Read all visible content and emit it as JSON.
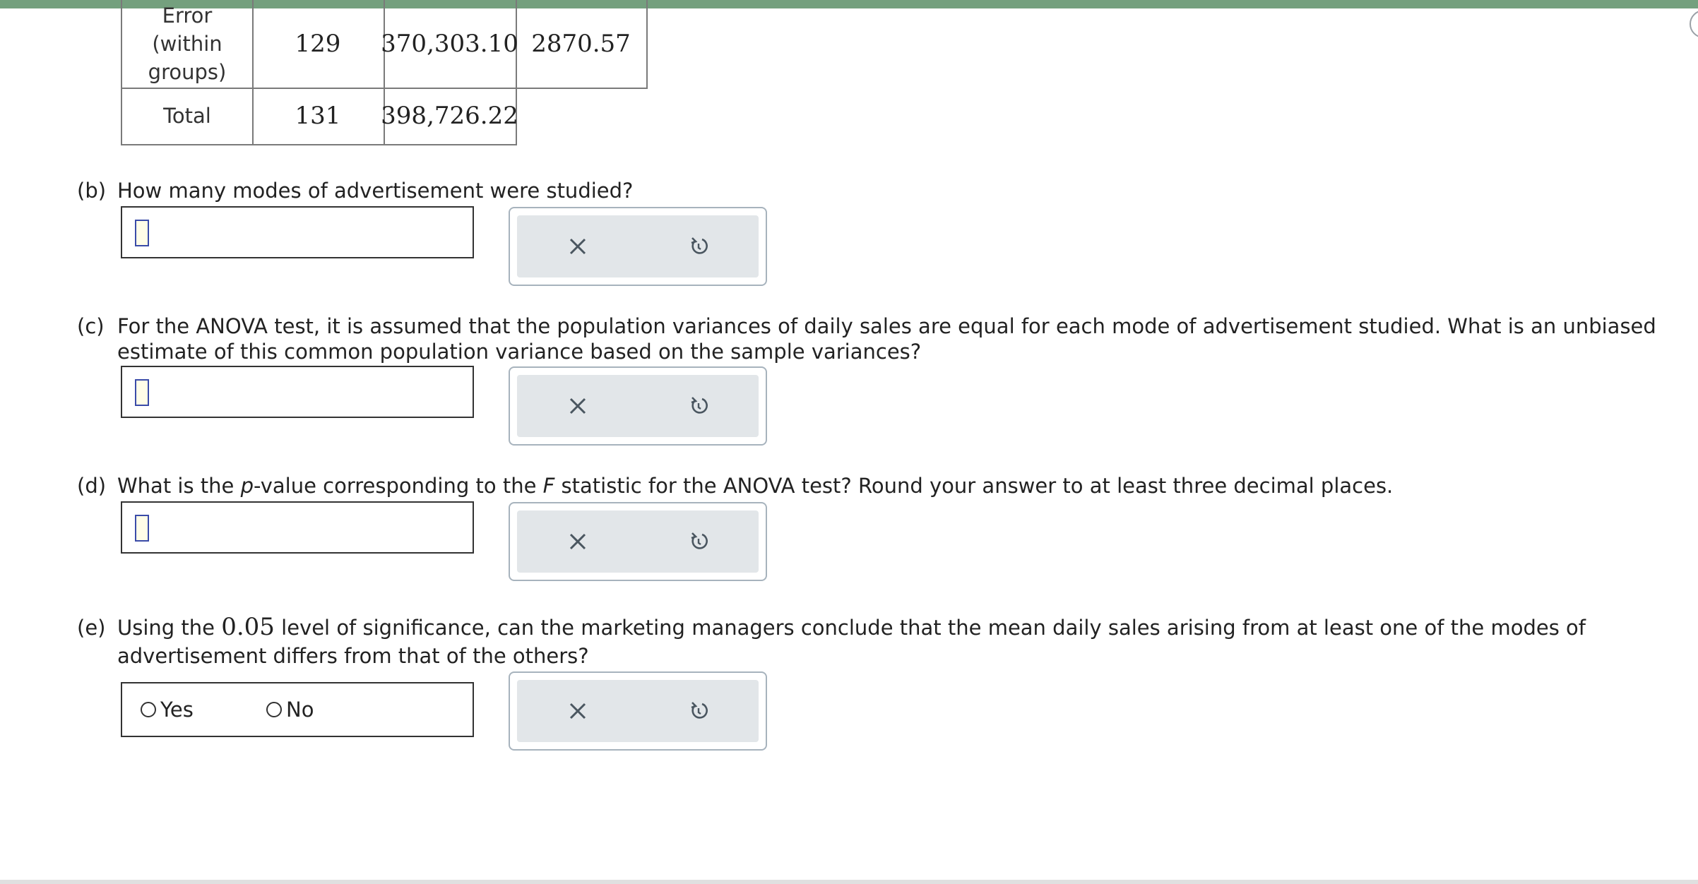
{
  "anova_table": {
    "rows": [
      {
        "source_label": "Error (within groups)",
        "df": "129",
        "ss": "370,303.10",
        "ms": "2870.57"
      },
      {
        "source_label": "Total",
        "df": "131",
        "ss": "398,726.22"
      }
    ]
  },
  "questions": {
    "b": {
      "prefix": "(b)",
      "text": "How many modes of advertisement were studied?"
    },
    "c": {
      "prefix": "(c)",
      "line1": "For the ANOVA test, it is assumed that the population variances of daily sales are equal for each mode of advertisement studied. What is an unbiased",
      "line2": "estimate of this common population variance based on the sample variances?"
    },
    "d": {
      "prefix": "(d)",
      "part1": "What is the ",
      "p": "p",
      "part2": "-value corresponding to the ",
      "F": "F",
      "part3": " statistic for the ANOVA test? Round your answer to at least three decimal places."
    },
    "e": {
      "prefix": "(e)",
      "part1": "Using the ",
      "alpha": "0.05",
      "part2": " level of significance, can the marketing managers conclude that the mean daily sales arising from at least one of the modes of",
      "line2": "advertisement differs from that of the others?",
      "options": [
        "Yes",
        "No"
      ]
    }
  },
  "tools": {
    "clear_icon": "close-icon",
    "reset_icon": "undo-icon"
  },
  "colors": {
    "accent_bar": "#74a07e",
    "tool_bg": "#e2e6e9",
    "cursor_border": "#3a4ba8"
  }
}
